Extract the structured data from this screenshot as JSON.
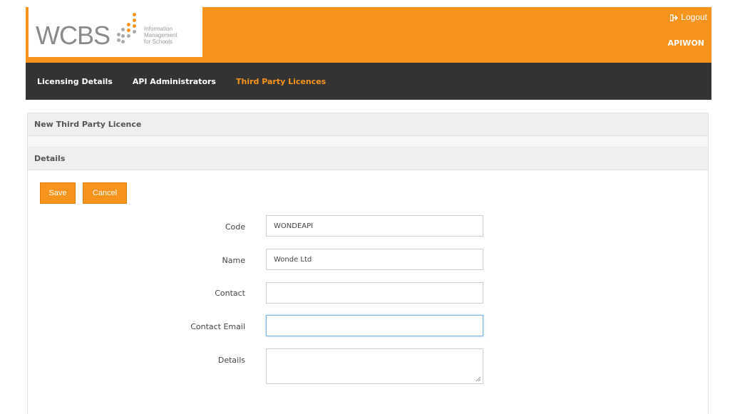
{
  "header": {
    "logo": {
      "brand": "WCBS",
      "tagline_lines": [
        "Information",
        "Management",
        "for Schools"
      ]
    },
    "logout_label": "Logout",
    "logout_icon": "sign-out-icon",
    "username": "APIWON",
    "brand_color": "#f7941d"
  },
  "nav": {
    "items": [
      {
        "label": "Licensing Details",
        "active": false
      },
      {
        "label": "API Administrators",
        "active": false
      },
      {
        "label": "Third Party Licences",
        "active": true
      }
    ]
  },
  "page": {
    "title": "New Third Party Licence",
    "section_title": "Details"
  },
  "actions": {
    "save_label": "Save",
    "cancel_label": "Cancel"
  },
  "form": {
    "code": {
      "label": "Code",
      "value": "WONDEAPI"
    },
    "name": {
      "label": "Name",
      "value": "Wonde Ltd"
    },
    "contact": {
      "label": "Contact",
      "value": ""
    },
    "contact_email": {
      "label": "Contact Email",
      "value": ""
    },
    "details": {
      "label": "Details",
      "value": ""
    }
  }
}
